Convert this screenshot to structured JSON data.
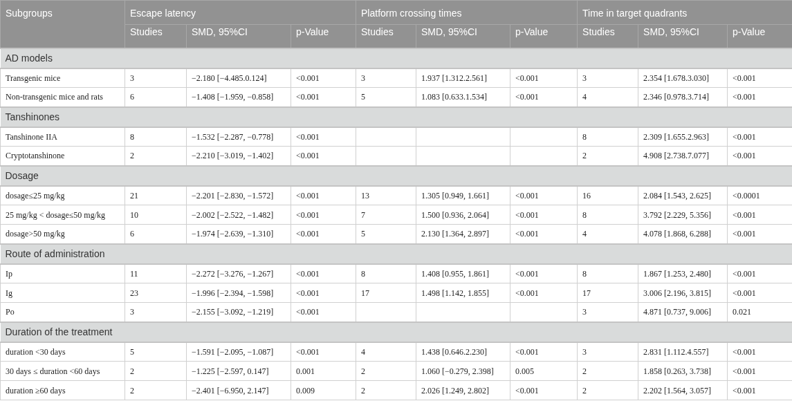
{
  "table": {
    "first_column": "Subgroups",
    "column_groups": [
      {
        "title": "Escape latency",
        "columns": [
          "Studies",
          "SMD, 95%CI",
          "p-Value"
        ]
      },
      {
        "title": "Platform crossing times",
        "columns": [
          "Studies",
          "SMD, 95%CI",
          "p-Value"
        ]
      },
      {
        "title": "Time in target quadrants",
        "columns": [
          "Studies",
          "SMD, 95%CI",
          "p-Value"
        ]
      }
    ],
    "sections": [
      {
        "title": "AD models",
        "rows": [
          {
            "subgroup": "Transgenic mice",
            "escape": [
              "3",
              "−2.180 [−4.485.0.124]",
              "<0.001"
            ],
            "platform": [
              "3",
              "1.937 [1.312.2.561]",
              "<0.001"
            ],
            "quadrant": [
              "3",
              "2.354 [1.678.3.030]",
              "<0.001"
            ]
          },
          {
            "subgroup": "Non-transgenic mice and rats",
            "escape": [
              "6",
              "−1.408 [−1.959, −0.858]",
              "<0.001"
            ],
            "platform": [
              "5",
              "1.083 [0.633.1.534]",
              "<0.001"
            ],
            "quadrant": [
              "4",
              "2.346 [0.978.3.714]",
              "<0.001"
            ]
          }
        ]
      },
      {
        "title": "Tanshinones",
        "rows": [
          {
            "subgroup": "Tanshinone IIA",
            "escape": [
              "8",
              "−1.532 [−2.287, −0.778]",
              "<0.001"
            ],
            "quadrant": [
              "8",
              "2.309 [1.655.2.963]",
              "<0.001"
            ]
          },
          {
            "subgroup": "Cryptotanshinone",
            "escape": [
              "2",
              "−2.210 [−3.019, −1.402]",
              "<0.001"
            ],
            "quadrant": [
              "2",
              "4.908 [2.738.7.077]",
              "<0.001"
            ]
          }
        ]
      },
      {
        "title": "Dosage",
        "rows": [
          {
            "subgroup": "dosage≤25 mg/kg",
            "escape": [
              "21",
              "−2.201 [−2.830, −1.572]",
              "<0.001"
            ],
            "platform": [
              "13",
              "1.305 [0.949, 1.661]",
              "<0.001"
            ],
            "quadrant": [
              "16",
              "2.084 [1.543, 2.625]",
              "<0.0001"
            ]
          },
          {
            "subgroup": "25 mg/kg < dosage≤50 mg/kg",
            "escape": [
              "10",
              "−2.002 [−2.522, −1.482]",
              "<0.001"
            ],
            "platform": [
              "7",
              "1.500 [0.936, 2.064]",
              "<0.001"
            ],
            "quadrant": [
              "8",
              "3.792 [2.229, 5.356]",
              "<0.001"
            ]
          },
          {
            "subgroup": "dosage>50 mg/kg",
            "escape": [
              "6",
              "−1.974 [−2.639, −1.310]",
              "<0.001"
            ],
            "platform": [
              "5",
              "2.130 [1.364, 2.897]",
              "<0.001"
            ],
            "quadrant": [
              "4",
              "4.078 [1.868, 6.288]",
              "<0.001"
            ]
          }
        ]
      },
      {
        "title": "Route of administration",
        "rows": [
          {
            "subgroup": "Ip",
            "escape": [
              "11",
              "−2.272 [−3.276, −1.267]",
              "<0.001"
            ],
            "platform": [
              "8",
              "1.408 [0.955, 1.861]",
              "<0.001"
            ],
            "quadrant": [
              "8",
              "1.867 [1.253, 2.480]",
              "<0.001"
            ]
          },
          {
            "subgroup": "Ig",
            "escape": [
              "23",
              "−1.996 [−2.394, −1.598]",
              "<0.001"
            ],
            "platform": [
              "17",
              "1.498 [1.142, 1.855]",
              "<0.001"
            ],
            "quadrant": [
              "17",
              "3.006 [2.196, 3.815]",
              "<0.001"
            ]
          },
          {
            "subgroup": "Po",
            "escape": [
              "3",
              "−2.155 [−3.092, −1.219]",
              "<0.001"
            ],
            "quadrant": [
              "3",
              "4.871 [0.737, 9.006]",
              "0.021"
            ]
          }
        ]
      },
      {
        "title": "Duration of the treatment",
        "rows": [
          {
            "subgroup": "duration <30 days",
            "escape": [
              "5",
              "−1.591 [−2.095, −1.087]",
              "<0.001"
            ],
            "platform": [
              "4",
              "1.438 [0.646.2.230]",
              "<0.001"
            ],
            "quadrant": [
              "3",
              "2.831 [1.112.4.557]",
              "<0.001"
            ]
          },
          {
            "subgroup": "30 days ≤ duration <60 days",
            "escape": [
              "2",
              "−1.225 [−2.597, 0.147]",
              "0.001"
            ],
            "platform": [
              "2",
              "1.060 [−0.279, 2.398]",
              "0.005"
            ],
            "quadrant": [
              "2",
              "1.858 [0.263, 3.738]",
              "<0.001"
            ]
          },
          {
            "subgroup": "duration ≥60 days",
            "escape": [
              "2",
              "−2.401 [−6.950, 2.147]",
              "0.009"
            ],
            "platform": [
              "2",
              "2.026 [1.249, 2.802]",
              "<0.001"
            ],
            "quadrant": [
              "2",
              "2.202 [1.564, 3.057]",
              "<0.001"
            ]
          }
        ]
      }
    ]
  }
}
